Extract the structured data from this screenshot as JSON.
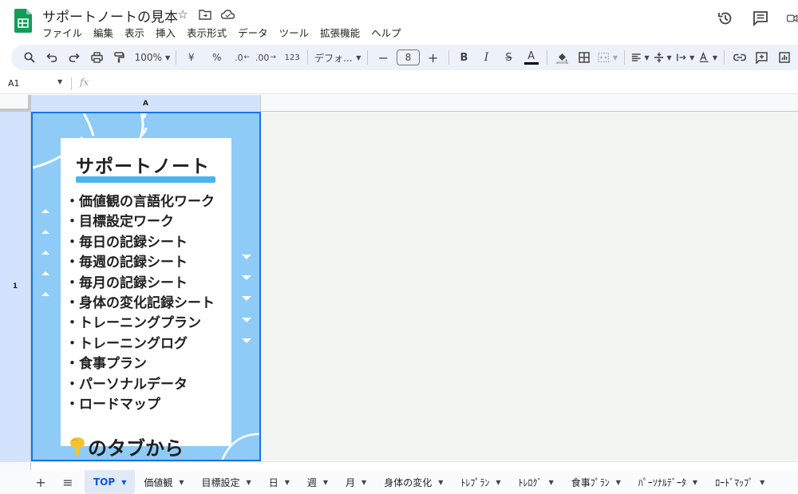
{
  "document": {
    "title": "サポートノートの見本"
  },
  "menu": [
    "ファイル",
    "編集",
    "表示",
    "挿入",
    "表示形式",
    "データ",
    "ツール",
    "拡張機能",
    "ヘルプ"
  ],
  "toolbar": {
    "zoom": "100%",
    "currency": "¥",
    "percent": "%",
    "decrease_decimal": ".0",
    "increase_decimal": ".00",
    "number_format": "123",
    "font_name": "デフォ...",
    "font_size": "8",
    "bold": "B",
    "italic": "I",
    "strikethrough": "S",
    "text_color": "A",
    "text_color_value": "#000000"
  },
  "formula_bar": {
    "cell_ref": "A1",
    "fx": "fx"
  },
  "grid": {
    "column_label": "A",
    "row_label": "1"
  },
  "embedded_image": {
    "title": "サポートノート",
    "items": [
      "・価値観の言語化ワーク",
      "・目標設定ワーク",
      "・毎日の記録シート",
      "・毎週の記録シート",
      "・毎月の記録シート",
      "・身体の変化記録シート",
      "・トレーニングプラン",
      "・トレーニングログ",
      "・食事プラン",
      "・パーソナルデータ",
      "・ロードマップ"
    ],
    "caption": "のタブから",
    "background_color": "#8ecbf7",
    "accent_color": "#4ab3f4"
  },
  "sheet_tabs": [
    {
      "label": "TOP",
      "active": true
    },
    {
      "label": "価値観",
      "active": false
    },
    {
      "label": "目標設定",
      "active": false
    },
    {
      "label": "日",
      "active": false
    },
    {
      "label": "週",
      "active": false
    },
    {
      "label": "月",
      "active": false
    },
    {
      "label": "身体の変化",
      "active": false
    },
    {
      "label": "ﾄﾚﾌﾟﾗﾝ",
      "active": false
    },
    {
      "label": "ﾄﾚﾛｸﾞ",
      "active": false
    },
    {
      "label": "食事ﾌﾟﾗﾝ",
      "active": false
    },
    {
      "label": "ﾊﾟｰｿﾅﾙﾃﾞｰﾀ",
      "active": false
    },
    {
      "label": "ﾛｰﾄﾞﾏｯﾌﾟ",
      "active": false
    }
  ],
  "colors": {
    "brand_green": "#0f9d58",
    "selection_blue": "#1a73e8",
    "active_tab_text": "#0b57d0"
  }
}
